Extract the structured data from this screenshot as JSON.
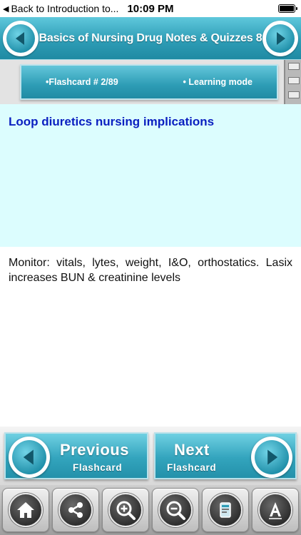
{
  "status_bar": {
    "back_label": "Back to Introduction to...",
    "time": "10:09 PM",
    "battery_level": 1.0
  },
  "header": {
    "title": "Basics of Nursing Drug Notes & Quizzes 8"
  },
  "card_info": {
    "flashcard_label": "•Flashcard #  2/89",
    "mode_label": "• Learning mode"
  },
  "question": {
    "text": "Loop diuretics nursing implications"
  },
  "answer": {
    "text": "Monitor: vitals, lytes, weight, I&O, orthostatics. Lasix increases BUN & creatinine levels"
  },
  "navigation": {
    "previous_main": "Previous",
    "previous_sub": "Flashcard",
    "next_main": "Next",
    "next_sub": "Flashcard"
  },
  "toolbar": {
    "icons": [
      "home-icon",
      "share-icon",
      "zoom-in-icon",
      "zoom-out-icon",
      "quiz-icon",
      "font-icon"
    ]
  },
  "colors": {
    "accent": "#2e9db6",
    "question_bg": "#dcfdfe",
    "question_text": "#0a1fc0"
  }
}
